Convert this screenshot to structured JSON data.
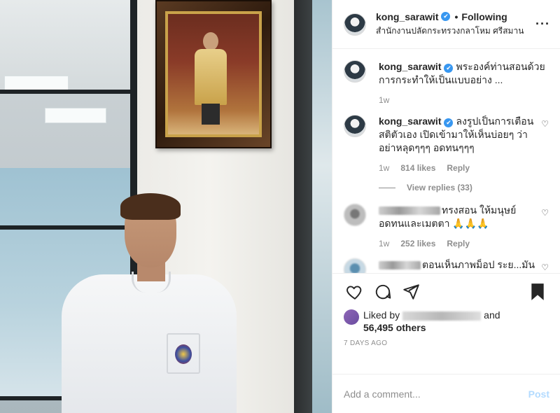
{
  "header": {
    "username": "kong_sarawit",
    "separator": "•",
    "follow_state": "Following",
    "location": "สำนักงานปลัดกระทรวงกลาโหม ศรีสมาน",
    "more": "···"
  },
  "comments": [
    {
      "username": "kong_sarawit",
      "text": "พระองค์ท่านสอนด้วยการกระทำให้เป็นแบบอย่าง ...",
      "time": "1w"
    },
    {
      "username": "kong_sarawit",
      "text": "ลงรูปเป็นการเตือนสติตัวเอง เปิดเข้ามาให้เห็นบ่อยๆ ว่าอย่าหลุดๆๆๆ อดทนๆๆๆ",
      "time": "1w",
      "likes": "814 likes",
      "reply": "Reply"
    },
    {
      "username": "",
      "text": "ทรงสอน ให้มนุษย์อดทนและเมตตา 🙏🙏🙏",
      "time": "1w",
      "likes": "252 likes",
      "reply": "Reply"
    },
    {
      "username": "",
      "text": "ตอนเห็นภาพม็อป ระย...มัน"
    }
  ],
  "view_replies": "View replies (33)",
  "likes": {
    "prefix": "Liked by",
    "and": "and",
    "others": "56,495 others"
  },
  "timestamp": "7 DAYS AGO",
  "add_comment": {
    "placeholder": "Add a comment...",
    "post_label": "Post"
  },
  "icons": {
    "like": "heart-icon",
    "comment": "comment-icon",
    "share": "share-icon",
    "save": "bookmark-icon"
  },
  "colors": {
    "verified": "#3897f0",
    "post_button": "#b3dbff",
    "secondary_text": "#8e8e8e"
  }
}
